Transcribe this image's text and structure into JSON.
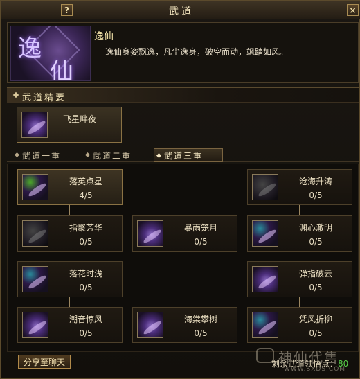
{
  "window": {
    "title": "武道",
    "help_label": "?",
    "close_label": "×"
  },
  "header": {
    "emblem_chars": [
      "逸",
      "仙"
    ],
    "name": "逸仙",
    "description": "逸仙身姿飘逸，凡尘逸身，破空而动，飒踏如风。"
  },
  "section": {
    "label": "武道精要"
  },
  "featured": {
    "name": "飞星畔夜",
    "icon": "flying-star-icon"
  },
  "tabs": [
    {
      "label": "武道一重",
      "active": false
    },
    {
      "label": "武道二重",
      "active": false
    },
    {
      "label": "武道三重",
      "active": true
    }
  ],
  "nodes": [
    {
      "name": "落英点星",
      "points": "4/5",
      "learned": true,
      "icon": "falling-star-icon"
    },
    {
      "name": "沧海升涛",
      "points": "0/5",
      "learned": false,
      "icon": "sea-wave-icon"
    },
    {
      "name": "指聚芳华",
      "points": "0/5",
      "learned": false,
      "icon": "finger-blossom-icon"
    },
    {
      "name": "暴雨笼月",
      "points": "0/5",
      "learned": false,
      "icon": "storm-moon-icon"
    },
    {
      "name": "渊心澈明",
      "points": "0/5",
      "learned": false,
      "icon": "abyss-heart-icon"
    },
    {
      "name": "落花时浅",
      "points": "0/5",
      "learned": false,
      "icon": "falling-flower-icon"
    },
    {
      "name": "弹指破云",
      "points": "0/5",
      "learned": false,
      "icon": "flick-cloud-icon"
    },
    {
      "name": "潮音惊风",
      "points": "0/5",
      "learned": false,
      "icon": "tide-wind-icon"
    },
    {
      "name": "海棠攀树",
      "points": "0/5",
      "learned": false,
      "icon": "begonia-tree-icon"
    },
    {
      "name": "凭风折柳",
      "points": "0/5",
      "learned": false,
      "icon": "wind-willow-icon"
    }
  ],
  "footer": {
    "share_label": "分享至聊天",
    "remaining_label": "剩余武道领悟点：",
    "remaining_value": "80"
  },
  "watermark": {
    "logo_text": "神仙代售",
    "url": "WWW.SXDS.COM"
  }
}
